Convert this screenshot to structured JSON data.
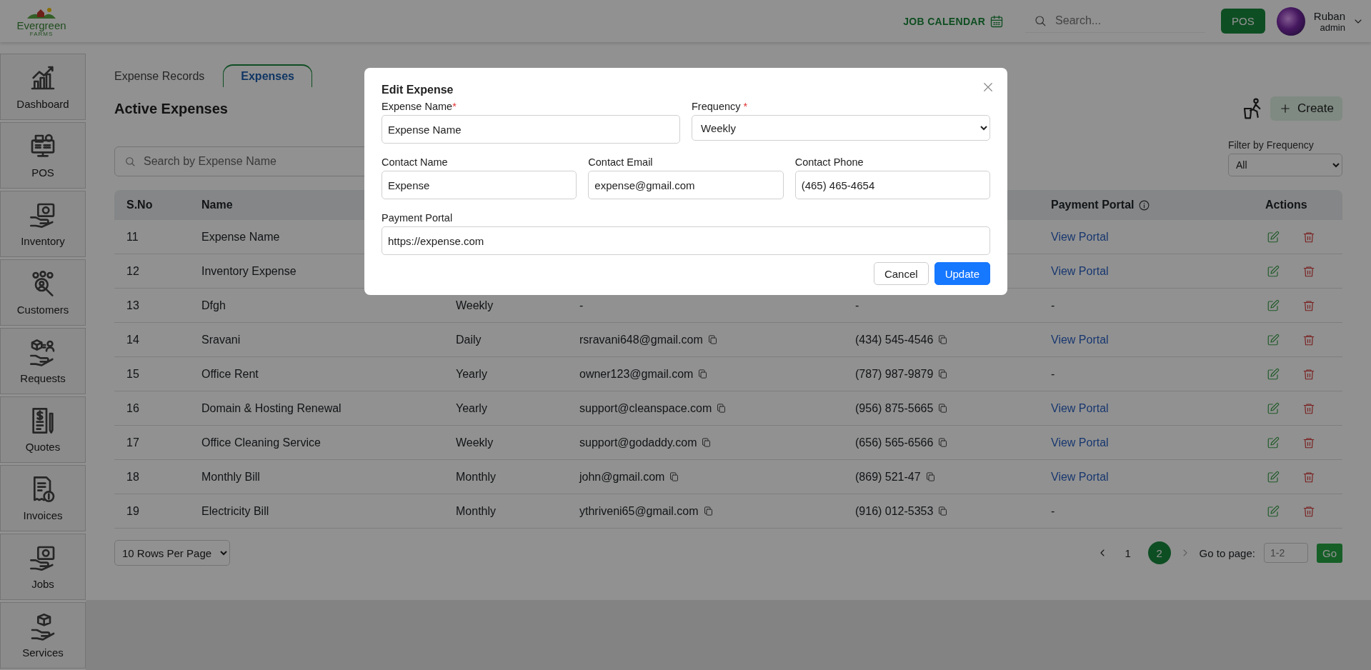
{
  "header": {
    "logo": {
      "name": "Evergreen",
      "tagline": "FARMS"
    },
    "job_calendar": "JOB CALENDAR",
    "search": {
      "placeholder": "Search..."
    },
    "pos_button": "POS",
    "user": {
      "name": "Ruban",
      "role": "admin"
    }
  },
  "sidebar": {
    "items": [
      {
        "label": "Dashboard",
        "kind": "chart"
      },
      {
        "label": "POS",
        "kind": "register"
      },
      {
        "label": "Inventory",
        "kind": "hand"
      },
      {
        "label": "Customers",
        "kind": "people"
      },
      {
        "label": "Requests",
        "kind": "exchange"
      },
      {
        "label": "Quotes",
        "kind": "quote"
      },
      {
        "label": "Invoices",
        "kind": "invoice"
      },
      {
        "label": "Jobs",
        "kind": "hand"
      },
      {
        "label": "Services",
        "kind": "box"
      }
    ]
  },
  "tabs": [
    {
      "label": "Expense Records",
      "selected": false
    },
    {
      "label": "Expenses",
      "selected": true
    }
  ],
  "page_title": "Active Expenses",
  "create_button": "Create",
  "search": {
    "placeholder": "Search by Expense Name"
  },
  "filter": {
    "label": "Filter by Frequency",
    "value": "All"
  },
  "table": {
    "columns": {
      "sno": "S.No",
      "name": "Name",
      "portal": "Payment Portal",
      "actions": "Actions"
    },
    "rows": [
      {
        "sno": "11",
        "name": "Expense Name",
        "portal": "View Portal"
      },
      {
        "sno": "12",
        "name": "Inventory Expense",
        "portal": "View Portal"
      },
      {
        "sno": "13",
        "name": "Dfgh",
        "frequency": "Weekly",
        "email": "-",
        "phone": "-",
        "portal": "-"
      },
      {
        "sno": "14",
        "name": "Sravani",
        "frequency": "Daily",
        "email": "rsravani648@gmail.com",
        "phone": "(434) 545-4546",
        "portal": "View Portal"
      },
      {
        "sno": "15",
        "name": "Office Rent",
        "frequency": "Yearly",
        "email": "owner123@gmail.com",
        "phone": "(787) 987-9879",
        "portal": "-"
      },
      {
        "sno": "16",
        "name": "Domain & Hosting Renewal",
        "frequency": "Yearly",
        "email": "support@cleanspace.com",
        "phone": "(956) 875-5665",
        "portal": "View Portal"
      },
      {
        "sno": "17",
        "name": "Office Cleaning Service",
        "frequency": "Weekly",
        "email": "support@godaddy.com",
        "phone": "(656) 565-6566",
        "portal": "View Portal"
      },
      {
        "sno": "18",
        "name": "Monthly Bill",
        "frequency": "Monthly",
        "email": "john@gmail.com",
        "phone": "(869) 521-47",
        "portal": "View Portal"
      },
      {
        "sno": "19",
        "name": "Electricity Bill",
        "frequency": "Monthly",
        "email": "ythriveni65@gmail.com",
        "phone": "(916) 012-5353",
        "portal": "-"
      }
    ]
  },
  "rows_per_page": "10 Rows Per Page",
  "pagination": {
    "pages": [
      {
        "label": "1",
        "selected": false
      },
      {
        "label": "2",
        "selected": true
      }
    ],
    "next_disabled": true,
    "goto_label": "Go to page:",
    "goto_placeholder": "1-2",
    "go_button": "Go"
  },
  "modal": {
    "title": "Edit Expense",
    "fields": [
      {
        "label": "Expense Name",
        "required_mark": "*",
        "kind": "input",
        "value": "Expense Name"
      },
      {
        "label": "Frequency",
        "required_mark": "*",
        "kind": "select",
        "value": "Weekly"
      },
      {
        "label": "Contact Name",
        "kind": "input",
        "value": "Expense"
      },
      {
        "label": "Contact Email",
        "kind": "input",
        "value": "expense@gmail.com"
      },
      {
        "label": "Contact Phone",
        "kind": "input",
        "value": "(465) 465-4654"
      },
      {
        "label": "Payment Portal",
        "kind": "input",
        "value": "https://expense.com"
      }
    ],
    "buttons": [
      {
        "label": "Cancel",
        "kind": "secondary"
      },
      {
        "label": "Update",
        "kind": "primary"
      }
    ]
  }
}
